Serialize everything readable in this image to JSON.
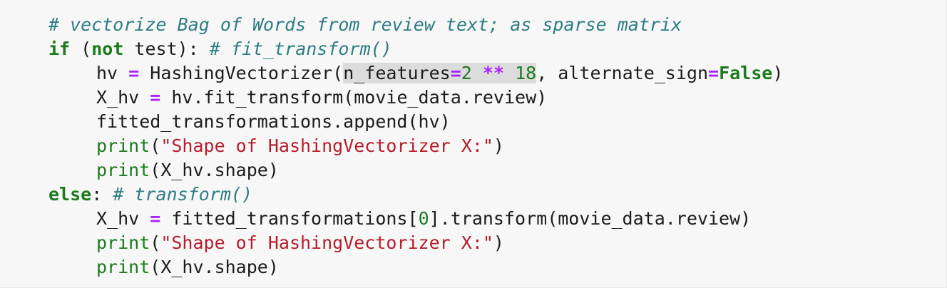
{
  "lines": [
    {
      "tokens": [
        {
          "t": "# vectorize Bag of Words from review text; as sparse matrix",
          "c": "cm"
        }
      ]
    },
    {
      "tokens": [
        {
          "t": "if",
          "c": "kw"
        },
        {
          "t": " (",
          "c": ""
        },
        {
          "t": "not",
          "c": "kw"
        },
        {
          "t": " test): ",
          "c": ""
        },
        {
          "t": "# fit_transform()",
          "c": "cm"
        }
      ]
    },
    {
      "indent": 1,
      "tokens": [
        {
          "t": "hv ",
          "c": ""
        },
        {
          "t": "=",
          "c": "op"
        },
        {
          "t": " HashingVectorizer(",
          "c": ""
        },
        {
          "t": "n_features",
          "c": "hl"
        },
        {
          "t": "=",
          "c": "op hl"
        },
        {
          "t": "2",
          "c": "num hl"
        },
        {
          "t": " ",
          "c": "hl"
        },
        {
          "t": "**",
          "c": "op hl"
        },
        {
          "t": " ",
          "c": "hl"
        },
        {
          "t": "18",
          "c": "num hl"
        },
        {
          "t": ", alternate_sign",
          "c": ""
        },
        {
          "t": "=",
          "c": "op"
        },
        {
          "t": "False",
          "c": "kw"
        },
        {
          "t": ")",
          "c": ""
        }
      ]
    },
    {
      "indent": 1,
      "tokens": [
        {
          "t": "X_hv ",
          "c": ""
        },
        {
          "t": "=",
          "c": "op"
        },
        {
          "t": " hv.fit_transform(movie_data.review)",
          "c": ""
        }
      ]
    },
    {
      "indent": 1,
      "tokens": [
        {
          "t": "fitted_transformations.append(hv)",
          "c": ""
        }
      ]
    },
    {
      "indent": 1,
      "tokens": [
        {
          "t": "print",
          "c": "bi"
        },
        {
          "t": "(",
          "c": ""
        },
        {
          "t": "\"Shape of HashingVectorizer X:\"",
          "c": "str"
        },
        {
          "t": ")",
          "c": ""
        }
      ]
    },
    {
      "indent": 1,
      "tokens": [
        {
          "t": "print",
          "c": "bi"
        },
        {
          "t": "(X_hv.shape)",
          "c": ""
        }
      ]
    },
    {
      "tokens": [
        {
          "t": "else",
          "c": "kw"
        },
        {
          "t": ": ",
          "c": ""
        },
        {
          "t": "# transform()",
          "c": "cm"
        }
      ]
    },
    {
      "indent": 1,
      "tokens": [
        {
          "t": "X_hv ",
          "c": ""
        },
        {
          "t": "=",
          "c": "op"
        },
        {
          "t": " fitted_transformations[",
          "c": ""
        },
        {
          "t": "0",
          "c": "num"
        },
        {
          "t": "].transform(movie_data.review)",
          "c": ""
        }
      ]
    },
    {
      "indent": 1,
      "tokens": [
        {
          "t": "print",
          "c": "bi"
        },
        {
          "t": "(",
          "c": ""
        },
        {
          "t": "\"Shape of HashingVectorizer X:\"",
          "c": "str"
        },
        {
          "t": ")",
          "c": ""
        }
      ]
    },
    {
      "indent": 1,
      "tokens": [
        {
          "t": "print",
          "c": "bi"
        },
        {
          "t": "(X_hv.shape)",
          "c": ""
        }
      ]
    }
  ]
}
